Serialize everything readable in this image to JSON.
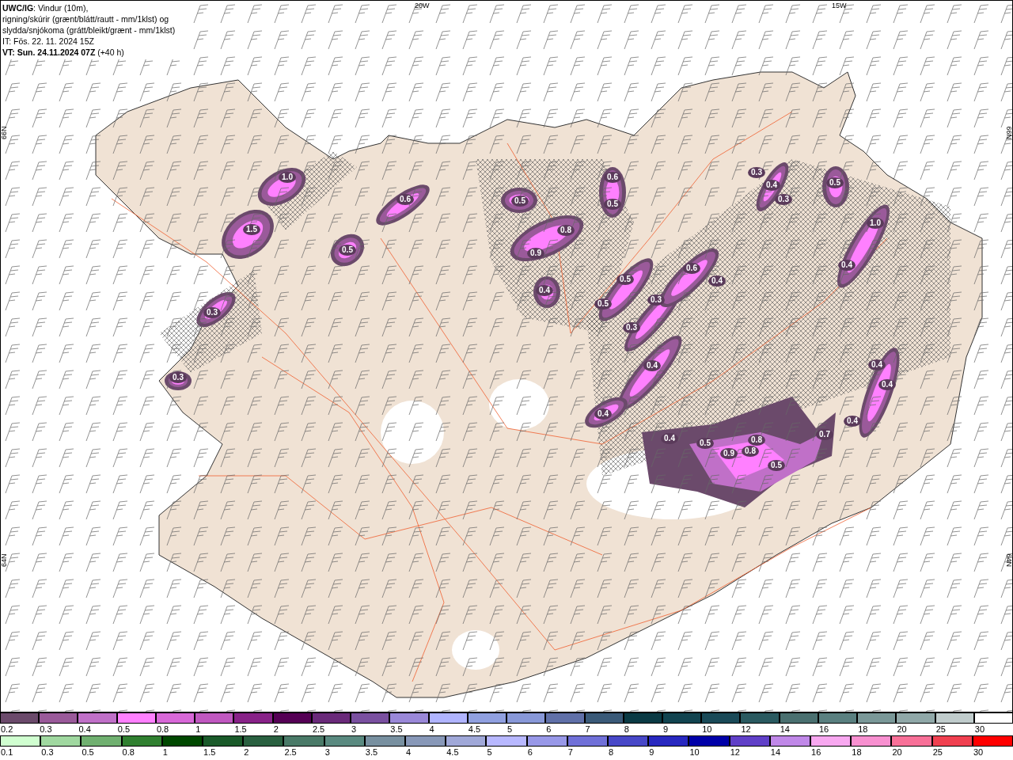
{
  "header": {
    "lines": [
      "**UWC/IG**: Vindur (10m),",
      "rigning/skúrir (grænt/blátt/rautt - mm/1klst) og",
      "slydda/snjókoma (grátt/bleikt/grænt - mm/1klst)",
      "IT: Fös. 22. 11. 2024 15Z",
      "**VT: Sun. 24.11.2024 07Z** (+40 h)"
    ]
  },
  "map": {
    "longitude_labels": [
      "20W",
      "15W"
    ],
    "latitude_labels_left": [
      "66N",
      "64N"
    ],
    "latitude_labels_right": [
      "66N",
      "64N"
    ],
    "values": [
      "1.0",
      "1.5",
      "0.6",
      "0.5",
      "0.3",
      "0.3",
      "0.5",
      "0.8",
      "0.9",
      "0.4",
      "0.6",
      "0.5",
      "0.5",
      "0.5",
      "0.3",
      "0.3",
      "0.6",
      "0.4",
      "0.4",
      "0.4",
      "0.3",
      "0.4",
      "0.3",
      "0.5",
      "1.0",
      "0.4",
      "0.4",
      "0.5",
      "0.9",
      "0.8",
      "0.8",
      "0.5",
      "0.7",
      "0.4",
      "0.4",
      "0.4"
    ]
  },
  "legends": [
    {
      "items": [
        {
          "label": "0.2",
          "color": "#6b4a6b"
        },
        {
          "label": "0.3",
          "color": "#9a5a9a"
        },
        {
          "label": "0.4",
          "color": "#c070c8"
        },
        {
          "label": "0.5",
          "color": "#ff80ff"
        },
        {
          "label": "0.8",
          "color": "#d868d8"
        },
        {
          "label": "1",
          "color": "#c058c0"
        },
        {
          "label": "1.5",
          "color": "#882288"
        },
        {
          "label": "2",
          "color": "#550055"
        },
        {
          "label": "2.5",
          "color": "#6a2a7a"
        },
        {
          "label": "3",
          "color": "#7a50a0"
        },
        {
          "label": "3.5",
          "color": "#9a88d8"
        },
        {
          "label": "4",
          "color": "#b0b4ff"
        },
        {
          "label": "4.5",
          "color": "#90a0e0"
        },
        {
          "label": "5",
          "color": "#8898d8"
        },
        {
          "label": "6",
          "color": "#6070a8"
        },
        {
          "label": "7",
          "color": "#3a5a78"
        },
        {
          "label": "8",
          "color": "#0a3a44"
        },
        {
          "label": "9",
          "color": "#124450"
        },
        {
          "label": "10",
          "color": "#1a4a58"
        },
        {
          "label": "12",
          "color": "#2a5a60"
        },
        {
          "label": "14",
          "color": "#4a7070"
        },
        {
          "label": "16",
          "color": "#5a8080"
        },
        {
          "label": "18",
          "color": "#7a9898"
        },
        {
          "label": "20",
          "color": "#90a8a8"
        },
        {
          "label": "25",
          "color": "#c0cccc"
        },
        {
          "label": "30",
          "color": "#ffffff"
        }
      ]
    },
    {
      "items": [
        {
          "label": "0.1",
          "color": "#d0ffd0"
        },
        {
          "label": "0.3",
          "color": "#a0d8a0"
        },
        {
          "label": "0.5",
          "color": "#70b070"
        },
        {
          "label": "0.8",
          "color": "#308030"
        },
        {
          "label": "1",
          "color": "#004800"
        },
        {
          "label": "1.5",
          "color": "#1a5a2a"
        },
        {
          "label": "2",
          "color": "#2a6040"
        },
        {
          "label": "2.5",
          "color": "#4a7a68"
        },
        {
          "label": "3",
          "color": "#5a8a80"
        },
        {
          "label": "3.5",
          "color": "#7890a0"
        },
        {
          "label": "4",
          "color": "#8898b8"
        },
        {
          "label": "4.5",
          "color": "#a0a8d8"
        },
        {
          "label": "5",
          "color": "#b8b8ff"
        },
        {
          "label": "6",
          "color": "#9898e8"
        },
        {
          "label": "7",
          "color": "#7070d8"
        },
        {
          "label": "8",
          "color": "#4848c8"
        },
        {
          "label": "9",
          "color": "#2828c0"
        },
        {
          "label": "10",
          "color": "#0000a8"
        },
        {
          "label": "12",
          "color": "#6040c8"
        },
        {
          "label": "14",
          "color": "#c088e8"
        },
        {
          "label": "16",
          "color": "#f8a8f0"
        },
        {
          "label": "18",
          "color": "#f890d0"
        },
        {
          "label": "20",
          "color": "#f87098"
        },
        {
          "label": "25",
          "color": "#f04050"
        },
        {
          "label": "30",
          "color": "#ff0000"
        }
      ]
    }
  ]
}
